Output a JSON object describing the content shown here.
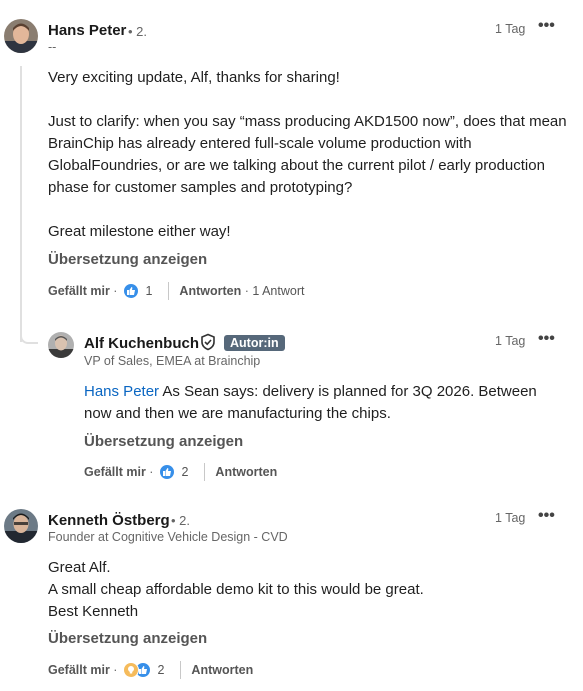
{
  "comments": [
    {
      "name": "Hans Peter",
      "degree": "• 2.",
      "subtitle": "--",
      "time": "1 Tag",
      "paragraphs": [
        "Very exciting update, Alf, thanks for sharing!",
        "Just to clarify: when you say “mass producing AKD1500 now”, does that mean BrainChip has already entered full-scale volume production with GlobalFoundries, or are we talking about the current pilot / early production phase for customer samples and prototyping?",
        "Great milestone either way!"
      ],
      "translate": "Übersetzung anzeigen",
      "like_label": "Gefällt mir",
      "reaction_count": "1",
      "reply_label": "Antworten",
      "reply_count": "1 Antwort"
    },
    {
      "name": "Alf Kuchenbuch",
      "badge": "Autor:in",
      "subtitle": "VP of Sales, EMEA at Brainchip",
      "time": "1 Tag",
      "mention": "Hans Peter",
      "text": "As Sean says: delivery is planned for 3Q 2026. Between now and then we are manufacturing the chips.",
      "translate": "Übersetzung anzeigen",
      "like_label": "Gefällt mir",
      "reaction_count": "2",
      "reply_label": "Antworten"
    },
    {
      "name": "Kenneth Östberg",
      "degree": "• 2.",
      "subtitle": "Founder at Cognitive Vehicle Design - CVD",
      "time": "1 Tag",
      "lines": [
        "Great Alf.",
        "A small cheap affordable demo kit to this would be great.",
        "Best Kenneth"
      ],
      "translate": "Übersetzung anzeigen",
      "like_label": "Gefällt mir",
      "reaction_count": "2",
      "reply_label": "Antworten"
    }
  ],
  "icons": {
    "more": "more-horizontal-icon",
    "verified": "shield-check-icon",
    "like": "thumbs-up-icon",
    "insightful": "lightbulb-icon"
  },
  "colors": {
    "accent": "#0a66c2",
    "like_blue": "#378fe9",
    "badge": "#56687a"
  }
}
